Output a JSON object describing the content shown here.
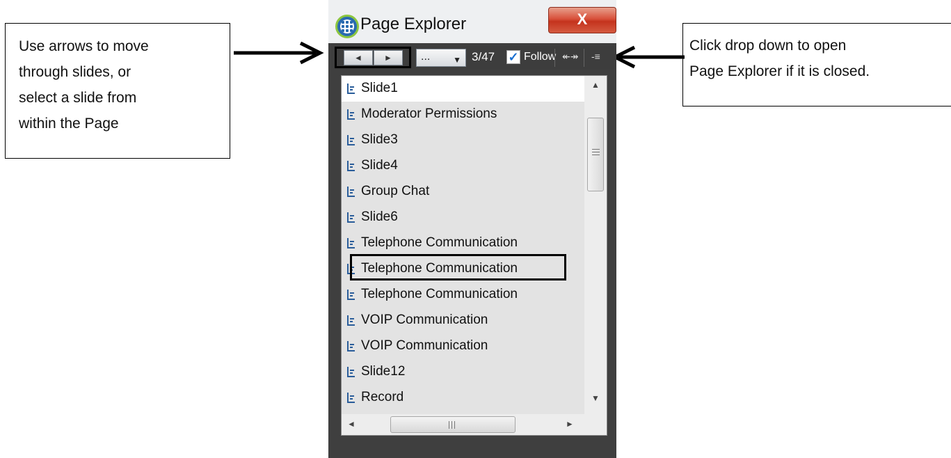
{
  "callouts": {
    "left": [
      "Use arrows to move",
      "through slides, or",
      "select a slide from",
      "within the Page"
    ],
    "right": [
      "Click drop down to open",
      "Page Explorer if it is closed."
    ]
  },
  "window": {
    "title": "Page Explorer",
    "close_label": "X"
  },
  "toolbar": {
    "prev_glyph": "◄",
    "next_glyph": "►",
    "dropdown_value": "...",
    "dropdown_arrow": "▼",
    "counter": "3/47",
    "follow_checked": true,
    "follow_check_glyph": "✓",
    "follow_label": "Follow",
    "swap_glyph": "↞↠",
    "menu_glyph": "-≡"
  },
  "slides": [
    {
      "label": "Slide1",
      "selected": true
    },
    {
      "label": "Moderator Permissions"
    },
    {
      "label": "Slide3"
    },
    {
      "label": "Slide4"
    },
    {
      "label": "Group Chat"
    },
    {
      "label": "Slide6"
    },
    {
      "label": "Telephone Communication"
    },
    {
      "label": "Telephone Communication",
      "highlighted": true
    },
    {
      "label": "Telephone Communication"
    },
    {
      "label": "VOIP Communication"
    },
    {
      "label": "VOIP Communication"
    },
    {
      "label": "Slide12"
    },
    {
      "label": "Record"
    }
  ],
  "scrollbars": {
    "up_glyph": "▲",
    "down_glyph": "▼",
    "left_glyph": "◄",
    "right_glyph": "►"
  },
  "colors": {
    "accent": "#2a6bb0",
    "close_button": "#c4331d",
    "panel_background": "#3f3f3f"
  }
}
